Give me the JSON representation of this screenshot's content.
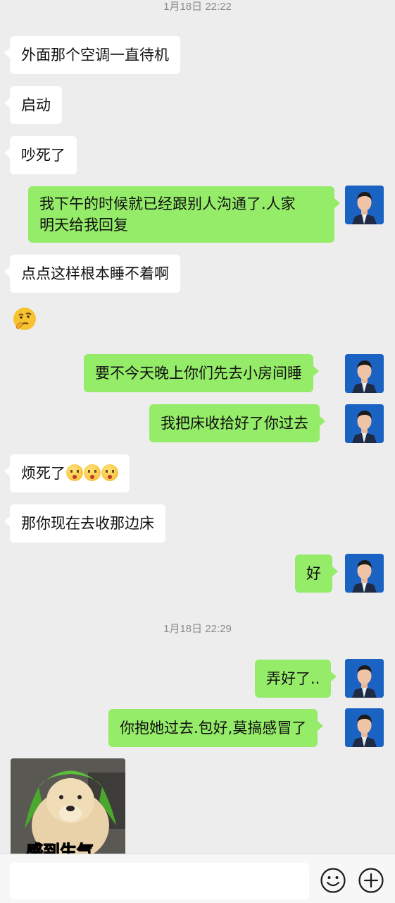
{
  "timestamps": [
    "1月18日 22:22",
    "1月18日 22:29"
  ],
  "messages": [
    {
      "side": "in",
      "text": "外面那个空调一直待机"
    },
    {
      "side": "in",
      "text": "启动"
    },
    {
      "side": "in",
      "text": "吵死了"
    },
    {
      "side": "out",
      "line1": "我下午的时候就已经跟别人沟通了.人家",
      "line2": "明天给我回复"
    },
    {
      "side": "in",
      "text": "点点这样根本睡不着啊"
    },
    {
      "side": "in",
      "sticker": "thinking-face-emoji"
    },
    {
      "side": "out",
      "text": "要不今天晚上你们先去小房间睡"
    },
    {
      "side": "out",
      "text": "我把床收拾好了你过去"
    },
    {
      "side": "in",
      "text": "烦死了",
      "emojis": [
        "flushed-face-emoji",
        "flushed-face-emoji",
        "flushed-face-emoji"
      ]
    },
    {
      "side": "in",
      "text": "那你现在去收那边床"
    },
    {
      "side": "out",
      "text": "好"
    },
    {
      "side": "out",
      "text": "弄好了.."
    },
    {
      "side": "out",
      "text": "你抱她过去.包好,莫搞感冒了"
    },
    {
      "side": "in",
      "sticker": "dog-with-green-hat-sticker",
      "partial_text": "感到生气"
    }
  ],
  "input": {
    "placeholder": ""
  },
  "icons": {
    "emoji_button": "smile-icon",
    "more_button": "plus-circle-icon"
  },
  "colors": {
    "background": "#ededed",
    "outgoing": "#95ec69",
    "incoming": "#ffffff"
  }
}
